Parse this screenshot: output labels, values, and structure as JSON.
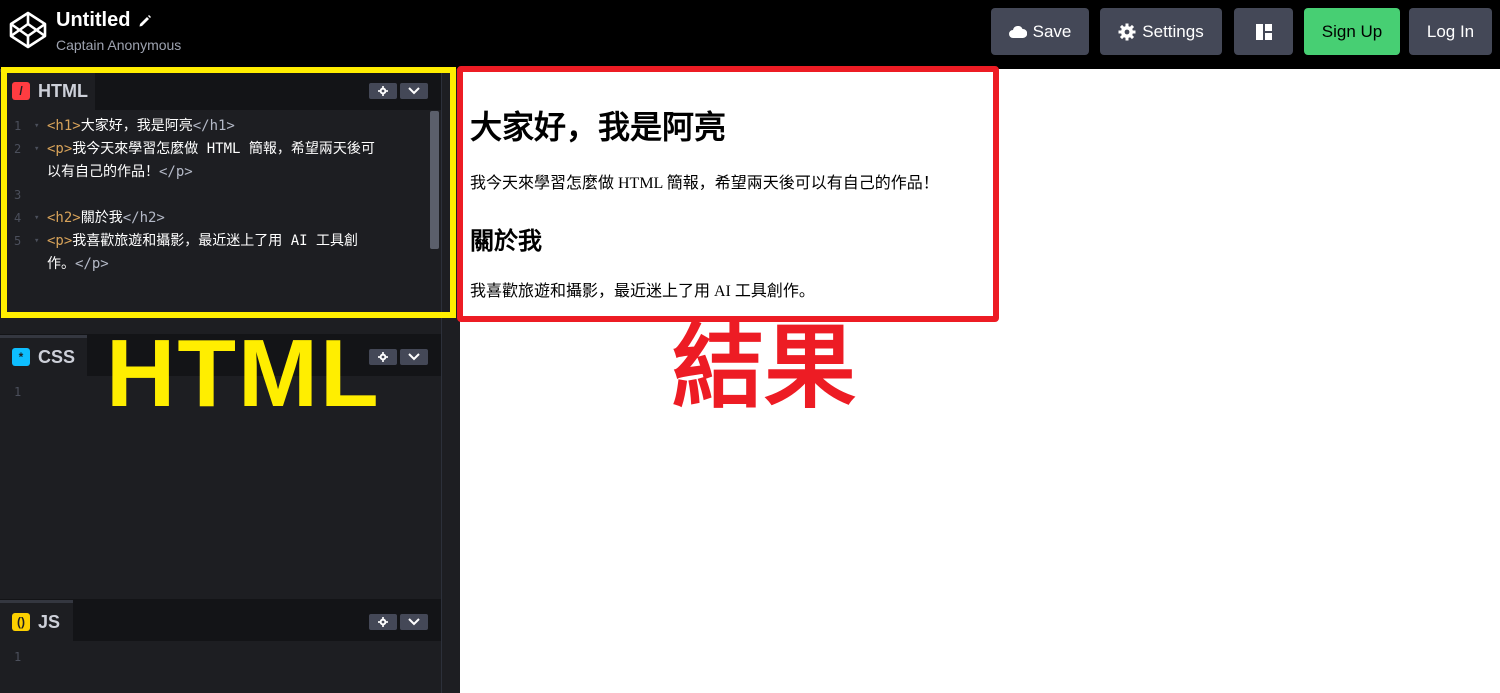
{
  "header": {
    "title": "Untitled",
    "subtitle": "Captain Anonymous",
    "buttons": {
      "save": "Save",
      "settings": "Settings",
      "signup": "Sign Up",
      "login": "Log In"
    }
  },
  "editors": {
    "html": {
      "label": "HTML",
      "icon": "/",
      "lines": [
        {
          "num": "1",
          "open": "<h1>",
          "text": "大家好，我是阿亮",
          "close": "</h1>"
        },
        {
          "num": "2",
          "open": "<p>",
          "text": "我今天來學習怎麼做 HTML 簡報，希望兩天後可",
          "close": ""
        },
        {
          "num": "",
          "open": "",
          "text": "以有自己的作品！",
          "close": "</p>"
        },
        {
          "num": "3",
          "open": "",
          "text": "",
          "close": ""
        },
        {
          "num": "4",
          "open": "<h2>",
          "text": "關於我",
          "close": "</h2>"
        },
        {
          "num": "5",
          "open": "<p>",
          "text": "我喜歡旅遊和攝影，最近迷上了用 AI 工具創",
          "close": ""
        },
        {
          "num": "",
          "open": "",
          "text": "作。",
          "close": "</p>"
        }
      ]
    },
    "css": {
      "label": "CSS",
      "icon": "*",
      "line": "1"
    },
    "js": {
      "label": "JS",
      "icon": "()",
      "line": "1"
    }
  },
  "result": {
    "h1": "大家好，我是阿亮",
    "p1": "我今天來學習怎麼做 HTML 簡報，希望兩天後可以有自己的作品！",
    "h2": "關於我",
    "p2": "我喜歡旅遊和攝影，最近迷上了用 AI 工具創作。"
  },
  "annotations": {
    "html_label": "HTML",
    "result_label": "結果",
    "html_color": "#ffee00",
    "result_color": "#ed1c24"
  },
  "colors": {
    "accent_green": "#47cf73",
    "button_gray": "#444857",
    "editor_bg": "#1d1e22"
  }
}
